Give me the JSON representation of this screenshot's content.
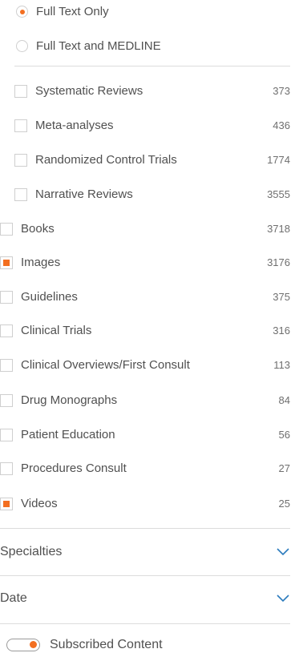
{
  "source_options": [
    {
      "label": "Full Text Only",
      "selected": true
    },
    {
      "label": "Full Text and MEDLINE",
      "selected": false
    }
  ],
  "subtypes": [
    {
      "label": "Systematic Reviews",
      "count": "373",
      "checked": false
    },
    {
      "label": "Meta-analyses",
      "count": "436",
      "checked": false
    },
    {
      "label": "Randomized Control Trials",
      "count": "1774",
      "checked": false
    },
    {
      "label": "Narrative Reviews",
      "count": "3555",
      "checked": false
    }
  ],
  "content_types": [
    {
      "label": "Books",
      "count": "3718",
      "checked": false
    },
    {
      "label": "Images",
      "count": "3176",
      "checked": true
    },
    {
      "label": "Guidelines",
      "count": "375",
      "checked": false
    },
    {
      "label": "Clinical Trials",
      "count": "316",
      "checked": false
    },
    {
      "label": "Clinical Overviews/First Consult",
      "count": "113",
      "checked": false
    },
    {
      "label": "Drug Monographs",
      "count": "84",
      "checked": false
    },
    {
      "label": "Patient Education",
      "count": "56",
      "checked": false
    },
    {
      "label": "Procedures Consult",
      "count": "27",
      "checked": false
    },
    {
      "label": "Videos",
      "count": "25",
      "checked": true
    }
  ],
  "sections": [
    {
      "title": "Specialties"
    },
    {
      "title": "Date"
    }
  ],
  "toggle": {
    "label": "Subscribed Content",
    "on": true
  },
  "colors": {
    "accent": "#f36f21",
    "chevron": "#2b7bbd",
    "text": "#505050",
    "border": "#dcdcdc"
  }
}
